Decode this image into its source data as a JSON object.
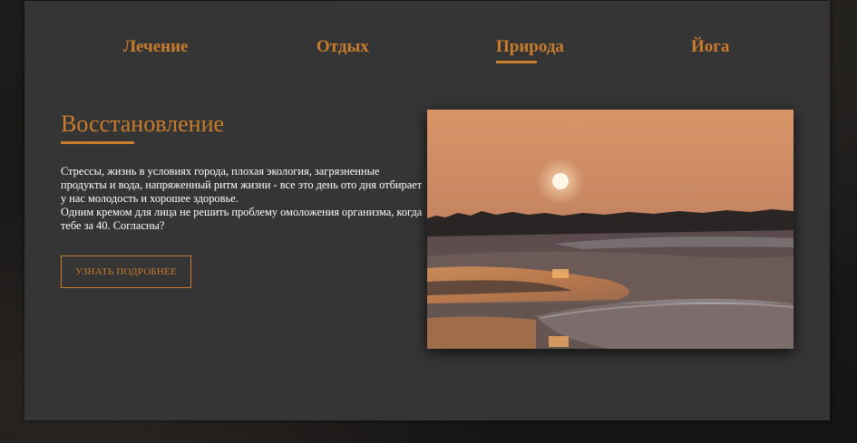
{
  "nav": {
    "items": [
      {
        "label": "Лечение"
      },
      {
        "label": "Отдых"
      },
      {
        "label": "Природа",
        "active": true
      },
      {
        "label": "Йога"
      }
    ]
  },
  "hero": {
    "title": "Восстановление",
    "paragraphs": [
      "Стрессы, жизнь в условиях города, плохая экология, загрязненные продукты и вода, напряженный ритм жизни - все это день ото дня отбирает у нас молодость и хорошее здоровье.",
      "Одним кремом для лица не решить проблему омоложения организма, когда тебе за 40. Согласны?"
    ],
    "cta_label": "Узнать подробнее",
    "image_subject": "sunset-over-beach-photo"
  },
  "colors": {
    "accent": "#c97c2c",
    "panel_bg": "#353535",
    "page_bg": "#1c1c1c",
    "text": "#ffffff"
  }
}
